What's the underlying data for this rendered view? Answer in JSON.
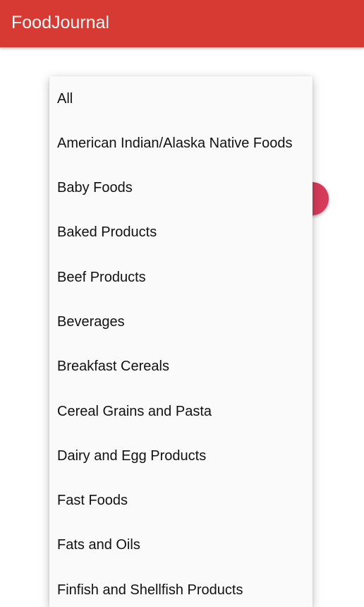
{
  "app_bar": {
    "title": "FoodJournal",
    "color": "#d63a33"
  },
  "fab": {
    "icon": "chevron-right-icon",
    "glyph": "›",
    "color": "#d63b5a"
  },
  "dropdown": {
    "background": "#fafafa",
    "options": [
      "All",
      "American Indian/Alaska Native Foods",
      "Baby Foods",
      "Baked Products",
      "Beef Products",
      "Beverages",
      "Breakfast Cereals",
      "Cereal Grains and Pasta",
      "Dairy and Egg Products",
      "Fast Foods",
      "Fats and Oils",
      "Finfish and Shellfish Products"
    ]
  }
}
